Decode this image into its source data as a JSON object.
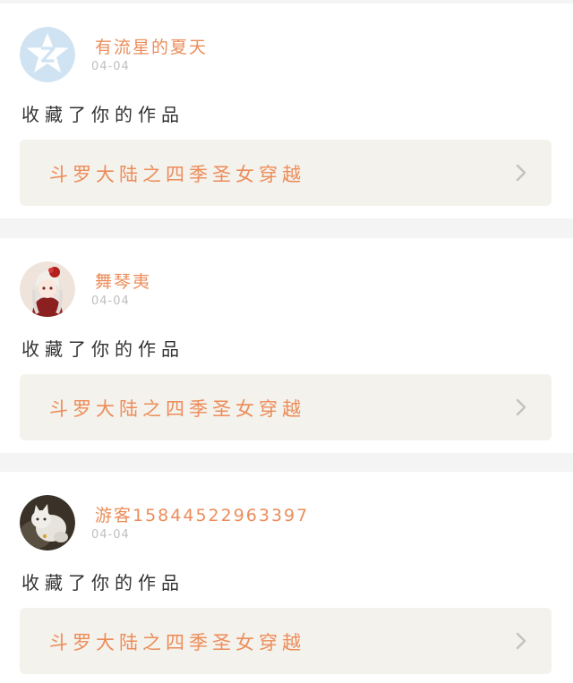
{
  "feed": {
    "items": [
      {
        "username": "有流星的夏天",
        "time": "04-04",
        "action": "收藏了你的作品",
        "work_title": "斗罗大陆之四季圣女穿越",
        "avatar_icon": "qq-star-avatar-icon"
      },
      {
        "username": "舞琴夷",
        "time": "04-04",
        "action": "收藏了你的作品",
        "work_title": "斗罗大陆之四季圣女穿越",
        "avatar_icon": "anime-girl-avatar-icon"
      },
      {
        "username": "游客15844522963397",
        "time": "04-04",
        "action": "收藏了你的作品",
        "work_title": "斗罗大陆之四季圣女穿越",
        "avatar_icon": "cat-avatar-icon"
      }
    ],
    "colors": {
      "accent": "#ec8c5a",
      "time": "#bfbfbf",
      "text": "#333333",
      "link_bg": "#f4f2ec",
      "page_bg": "#f4f4f4"
    }
  }
}
